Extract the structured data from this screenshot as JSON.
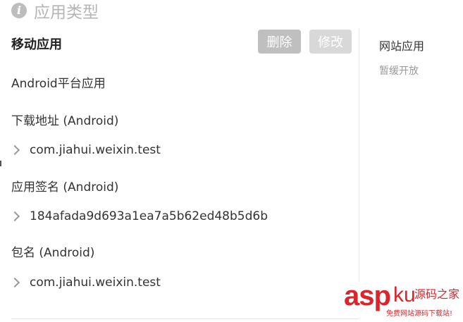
{
  "header": {
    "icon": "info-icon",
    "icon_glyph": "i",
    "title": "应用类型"
  },
  "mobile": {
    "title": "移动应用",
    "delete_label": "删除",
    "edit_label": "修改",
    "platform": "Android平台应用",
    "sections": [
      {
        "label": "下载地址 (Android)",
        "value": "com.jiahui.weixin.test"
      },
      {
        "label": "应用签名 (Android)",
        "value": "184afada9d693a1ea7a5b62ed48b5d6b"
      },
      {
        "label": "包名 (Android)",
        "value": "com.jiahui.weixin.test"
      }
    ]
  },
  "web": {
    "title": "网站应用",
    "status": "暂缓开放"
  },
  "watermark": {
    "asp": "asp",
    "ku": "ku",
    "cn": "源码之家",
    "sub": "免费网站源码下载站!"
  },
  "colors": {
    "button_delete": "#bfbfbf",
    "button_edit": "#d8d8d8",
    "header_text": "#b5b5b5",
    "watermark": "#d9252b"
  }
}
